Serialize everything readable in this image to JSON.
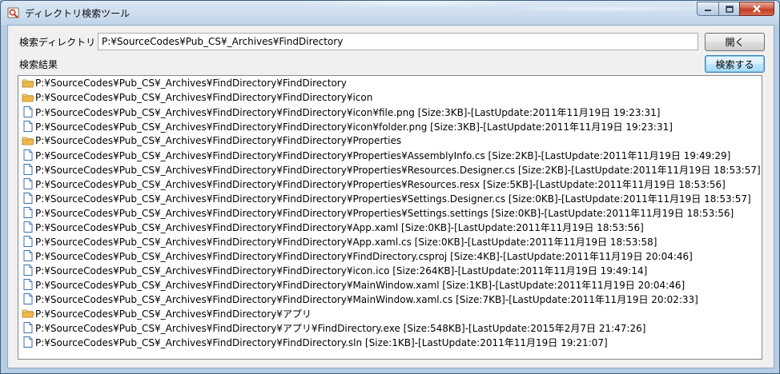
{
  "window": {
    "title": "ディレクトリ検索ツール"
  },
  "caption": {
    "minimize_glyph": "—",
    "maximize_glyph": "□",
    "close_glyph": "✕"
  },
  "search_dir": {
    "label": "検索ディレクトリ",
    "value": "P:¥SourceCodes¥Pub_CS¥_Archives¥FindDirectory"
  },
  "buttons": {
    "open_label": "開く",
    "search_label": "検索する"
  },
  "results": {
    "label": "検索結果",
    "items": [
      {
        "icon": "folder-icon",
        "text": "P:¥SourceCodes¥Pub_CS¥_Archives¥FindDirectory¥FindDirectory"
      },
      {
        "icon": "folder-icon",
        "text": "P:¥SourceCodes¥Pub_CS¥_Archives¥FindDirectory¥FindDirectory¥icon"
      },
      {
        "icon": "file-icon",
        "text": "P:¥SourceCodes¥Pub_CS¥_Archives¥FindDirectory¥FindDirectory¥icon¥file.png [Size:3KB]-[LastUpdate:2011年11月19日 19:23:31]"
      },
      {
        "icon": "file-icon",
        "text": "P:¥SourceCodes¥Pub_CS¥_Archives¥FindDirectory¥FindDirectory¥icon¥folder.png [Size:3KB]-[LastUpdate:2011年11月19日 19:23:31]"
      },
      {
        "icon": "folder-icon",
        "text": "P:¥SourceCodes¥Pub_CS¥_Archives¥FindDirectory¥FindDirectory¥Properties"
      },
      {
        "icon": "file-icon",
        "text": "P:¥SourceCodes¥Pub_CS¥_Archives¥FindDirectory¥FindDirectory¥Properties¥AssemblyInfo.cs [Size:2KB]-[LastUpdate:2011年11月19日 19:49:29]"
      },
      {
        "icon": "file-icon",
        "text": "P:¥SourceCodes¥Pub_CS¥_Archives¥FindDirectory¥FindDirectory¥Properties¥Resources.Designer.cs [Size:2KB]-[LastUpdate:2011年11月19日 18:53:57]"
      },
      {
        "icon": "file-icon",
        "text": "P:¥SourceCodes¥Pub_CS¥_Archives¥FindDirectory¥FindDirectory¥Properties¥Resources.resx [Size:5KB]-[LastUpdate:2011年11月19日 18:53:56]"
      },
      {
        "icon": "file-icon",
        "text": "P:¥SourceCodes¥Pub_CS¥_Archives¥FindDirectory¥FindDirectory¥Properties¥Settings.Designer.cs [Size:0KB]-[LastUpdate:2011年11月19日 18:53:57]"
      },
      {
        "icon": "file-icon",
        "text": "P:¥SourceCodes¥Pub_CS¥_Archives¥FindDirectory¥FindDirectory¥Properties¥Settings.settings [Size:0KB]-[LastUpdate:2011年11月19日 18:53:56]"
      },
      {
        "icon": "file-icon",
        "text": "P:¥SourceCodes¥Pub_CS¥_Archives¥FindDirectory¥FindDirectory¥App.xaml [Size:0KB]-[LastUpdate:2011年11月19日 18:53:56]"
      },
      {
        "icon": "file-icon",
        "text": "P:¥SourceCodes¥Pub_CS¥_Archives¥FindDirectory¥FindDirectory¥App.xaml.cs [Size:0KB]-[LastUpdate:2011年11月19日 18:53:58]"
      },
      {
        "icon": "file-icon",
        "text": "P:¥SourceCodes¥Pub_CS¥_Archives¥FindDirectory¥FindDirectory¥FindDirectory.csproj [Size:4KB]-[LastUpdate:2011年11月19日 20:04:46]"
      },
      {
        "icon": "file-icon",
        "text": "P:¥SourceCodes¥Pub_CS¥_Archives¥FindDirectory¥FindDirectory¥icon.ico [Size:264KB]-[LastUpdate:2011年11月19日 19:49:14]"
      },
      {
        "icon": "file-icon",
        "text": "P:¥SourceCodes¥Pub_CS¥_Archives¥FindDirectory¥FindDirectory¥MainWindow.xaml [Size:1KB]-[LastUpdate:2011年11月19日 20:04:46]"
      },
      {
        "icon": "file-icon",
        "text": "P:¥SourceCodes¥Pub_CS¥_Archives¥FindDirectory¥FindDirectory¥MainWindow.xaml.cs [Size:7KB]-[LastUpdate:2011年11月19日 20:02:33]"
      },
      {
        "icon": "folder-icon",
        "text": "P:¥SourceCodes¥Pub_CS¥_Archives¥FindDirectory¥アプリ"
      },
      {
        "icon": "file-icon",
        "text": "P:¥SourceCodes¥Pub_CS¥_Archives¥FindDirectory¥アプリ¥FindDirectory.exe [Size:548KB]-[LastUpdate:2015年2月7日 21:47:26]"
      },
      {
        "icon": "file-icon",
        "text": "P:¥SourceCodes¥Pub_CS¥_Archives¥FindDirectory¥FindDirectory.sln [Size:1KB]-[LastUpdate:2011年11月19日 19:21:07]"
      }
    ]
  },
  "colors": {
    "accent": "#3c7fb1",
    "folder": "#f0c050",
    "file_outline": "#4a7fb8"
  }
}
